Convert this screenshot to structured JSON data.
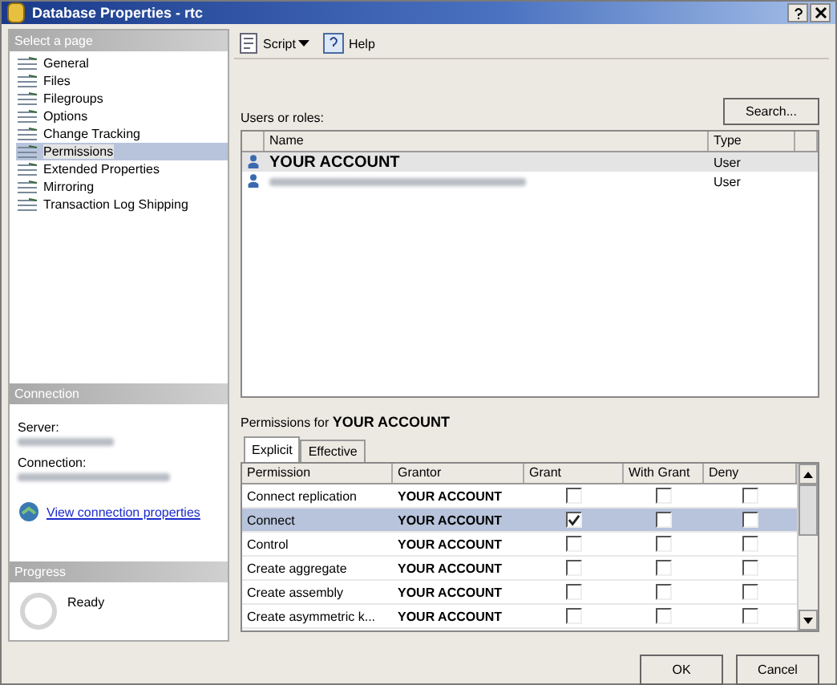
{
  "window": {
    "title": "Database Properties - rtc"
  },
  "select_page": {
    "header": "Select a page",
    "items": [
      {
        "label": "General",
        "selected": false
      },
      {
        "label": "Files",
        "selected": false
      },
      {
        "label": "Filegroups",
        "selected": false
      },
      {
        "label": "Options",
        "selected": false
      },
      {
        "label": "Change Tracking",
        "selected": false
      },
      {
        "label": "Permissions",
        "selected": true
      },
      {
        "label": "Extended Properties",
        "selected": false
      },
      {
        "label": "Mirroring",
        "selected": false
      },
      {
        "label": "Transaction Log Shipping",
        "selected": false
      }
    ]
  },
  "connection": {
    "header": "Connection",
    "server_label": "Server:",
    "server_redacted": true,
    "connection_label": "Connection:",
    "connection_redacted": true,
    "link": "View connection properties"
  },
  "progress": {
    "header": "Progress",
    "status": "Ready"
  },
  "toolbar": [
    {
      "label": "Script",
      "kind": "script",
      "dropdown": true
    },
    {
      "label": "Help",
      "kind": "help",
      "dropdown": false
    }
  ],
  "users": {
    "label": "Users or roles:",
    "search_button": "Search...",
    "columns": [
      "Name",
      "Type"
    ],
    "rows": [
      {
        "name": "YOUR ACCOUNT",
        "type": "User",
        "selected": true,
        "redacted": false
      },
      {
        "type": "User",
        "selected": false,
        "redacted": true
      }
    ]
  },
  "permissions": {
    "label": "Permissions for ",
    "account": "YOUR ACCOUNT",
    "tabs": [
      {
        "label": "Explicit",
        "selected": true
      },
      {
        "label": "Effective",
        "selected": false
      }
    ],
    "columns": [
      "Permission",
      "Grantor",
      "Grant",
      "With Grant",
      "Deny"
    ],
    "rows": [
      {
        "permission": "Connect replication",
        "grantor": "YOUR ACCOUNT",
        "grant": false,
        "with_grant": false,
        "deny": false,
        "selected": false
      },
      {
        "permission": "Connect",
        "grantor": "YOUR ACCOUNT",
        "grant": true,
        "with_grant": false,
        "deny": false,
        "selected": true
      },
      {
        "permission": "Control",
        "grantor": "YOUR ACCOUNT",
        "grant": false,
        "with_grant": false,
        "deny": false,
        "selected": false
      },
      {
        "permission": "Create aggregate",
        "grantor": "YOUR ACCOUNT",
        "grant": false,
        "with_grant": false,
        "deny": false,
        "selected": false
      },
      {
        "permission": "Create assembly",
        "grantor": "YOUR ACCOUNT",
        "grant": false,
        "with_grant": false,
        "deny": false,
        "selected": false
      },
      {
        "permission": "Create asymmetric k...",
        "grantor": "YOUR ACCOUNT",
        "grant": false,
        "with_grant": false,
        "deny": false,
        "selected": false
      }
    ]
  },
  "buttons": [
    "OK",
    "Cancel"
  ]
}
